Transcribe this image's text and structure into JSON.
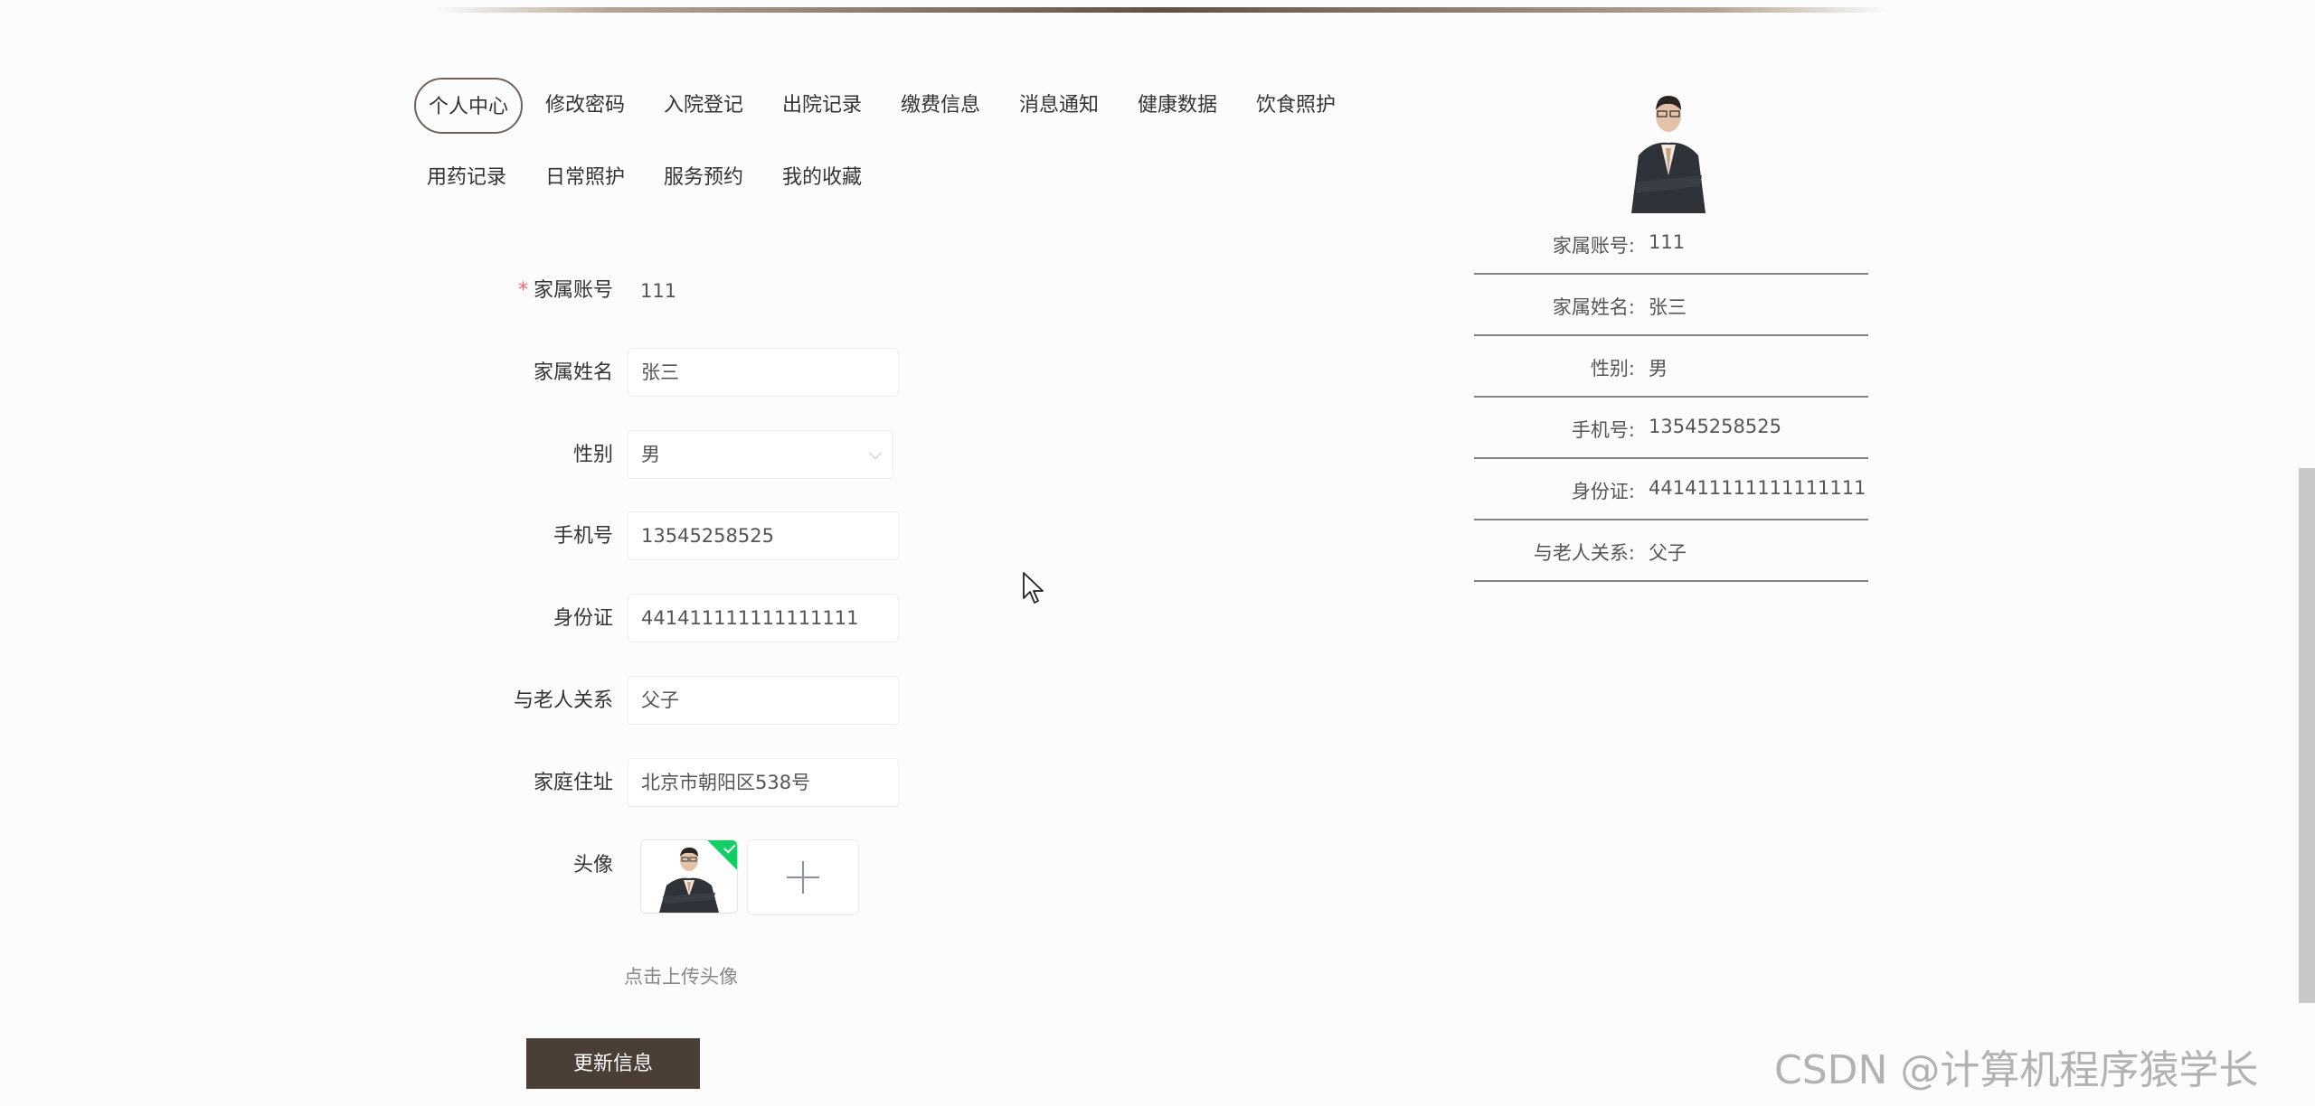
{
  "nav": {
    "tabs": [
      {
        "label": "个人中心",
        "active": true
      },
      {
        "label": "修改密码"
      },
      {
        "label": "入院登记"
      },
      {
        "label": "出院记录"
      },
      {
        "label": "缴费信息"
      },
      {
        "label": "消息通知"
      },
      {
        "label": "健康数据"
      },
      {
        "label": "饮食照护"
      },
      {
        "label": "用药记录"
      },
      {
        "label": "日常照护"
      },
      {
        "label": "服务预约"
      },
      {
        "label": "我的收藏"
      }
    ]
  },
  "form": {
    "account": {
      "label": "家属账号",
      "value": "111"
    },
    "name": {
      "label": "家属姓名",
      "value": "张三"
    },
    "gender": {
      "label": "性别",
      "value": "男"
    },
    "phone": {
      "label": "手机号",
      "value": "13545258525"
    },
    "id_card": {
      "label": "身份证",
      "value": "441411111111111111"
    },
    "relation": {
      "label": "与老人关系",
      "value": "父子"
    },
    "address": {
      "label": "家庭住址",
      "value": "北京市朝阳区538号"
    },
    "avatar": {
      "label": "头像"
    },
    "upload_tip": "点击上传头像",
    "submit_label": "更新信息"
  },
  "profile": {
    "rows": [
      {
        "label": "家属账号:",
        "value": "111"
      },
      {
        "label": "家属姓名:",
        "value": "张三"
      },
      {
        "label": "性别:",
        "value": "男"
      },
      {
        "label": "手机号:",
        "value": "13545258525"
      },
      {
        "label": "身份证:",
        "value": "441411111111111111"
      },
      {
        "label": "与老人关系:",
        "value": "父子"
      }
    ]
  },
  "watermark": "CSDN @计算机程序猿学长",
  "colors": {
    "accent": "#4a3e37",
    "success_badge": "#13ce66",
    "required": "#f56c6c"
  }
}
